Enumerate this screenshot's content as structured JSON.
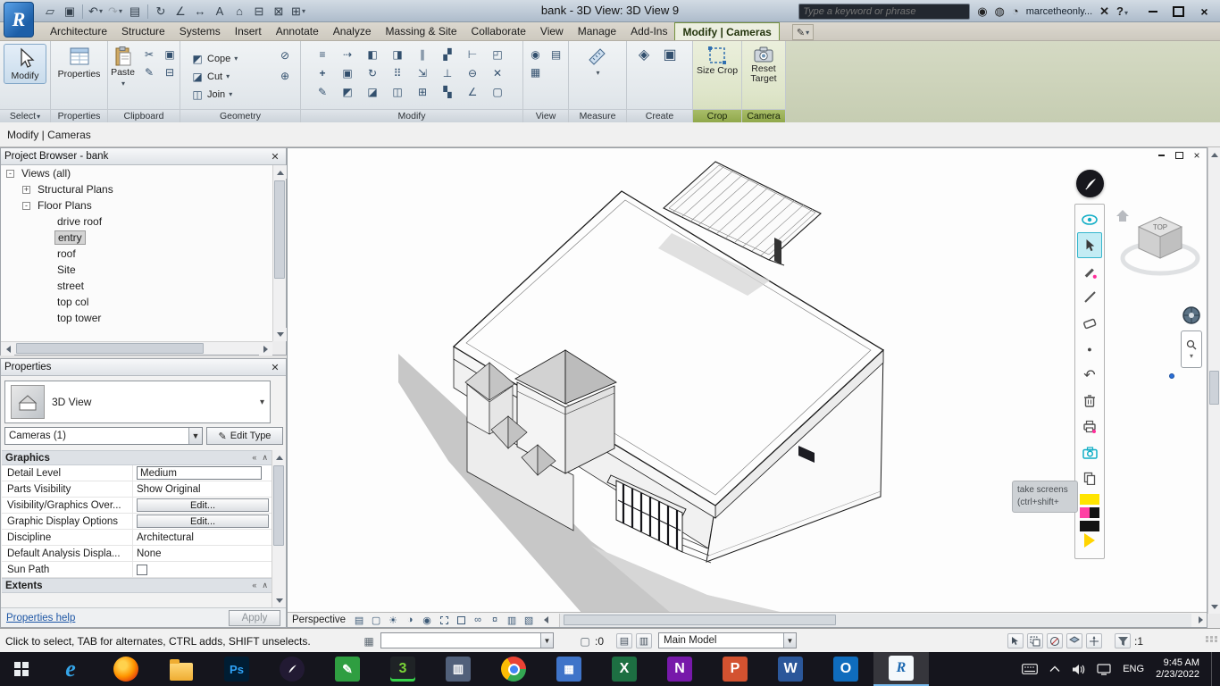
{
  "window": {
    "title": "bank - 3D View: 3D View 9",
    "search_placeholder": "Type a keyword or phrase",
    "user": "marcetheonly..."
  },
  "tabs": {
    "items": [
      "Architecture",
      "Structure",
      "Systems",
      "Insert",
      "Annotate",
      "Analyze",
      "Massing & Site",
      "Collaborate",
      "View",
      "Manage",
      "Add-Ins"
    ],
    "contextual": "Modify | Cameras"
  },
  "ribbon": {
    "select": {
      "button": "Modify",
      "label": "Select"
    },
    "properties_label": "Properties",
    "clipboard": {
      "paste": "Paste",
      "label": "Clipboard"
    },
    "geometry": {
      "cope": "Cope",
      "cut": "Cut",
      "join": "Join",
      "label": "Geometry"
    },
    "modify_label": "Modify",
    "view_label": "View",
    "measure_label": "Measure",
    "create_label": "Create",
    "crop": {
      "button": "Size Crop",
      "label": "Crop"
    },
    "camera": {
      "button": "Reset Target",
      "label": "Camera"
    }
  },
  "options_bar": {
    "label": "Modify | Cameras"
  },
  "project_browser": {
    "title": "Project Browser - bank",
    "items": [
      {
        "label": "Views (all)",
        "expander": "-"
      },
      {
        "label": "Structural Plans",
        "expander": "+"
      },
      {
        "label": "Floor Plans",
        "expander": "-"
      },
      {
        "label": "drive roof"
      },
      {
        "label": "entry"
      },
      {
        "label": "roof"
      },
      {
        "label": "Site"
      },
      {
        "label": "street"
      },
      {
        "label": "top col"
      },
      {
        "label": "top tower"
      }
    ]
  },
  "properties": {
    "title": "Properties",
    "type_selector": "3D View",
    "instance_filter": "Cameras (1)",
    "edit_type": "Edit Type",
    "graphics_header": "Graphics",
    "extents_header": "Extents",
    "rows": [
      {
        "label": "Detail Level",
        "value": "Medium"
      },
      {
        "label": "Parts Visibility",
        "value": "Show Original"
      },
      {
        "label": "Visibility/Graphics Over...",
        "value": "Edit..."
      },
      {
        "label": "Graphic Display Options",
        "value": "Edit..."
      },
      {
        "label": "Discipline",
        "value": "Architectural"
      },
      {
        "label": "Default Analysis Displa...",
        "value": "None"
      },
      {
        "label": "Sun Path",
        "value": ""
      }
    ],
    "help": "Properties help",
    "apply": "Apply"
  },
  "viewport": {
    "cube_top": "TOP",
    "tooltip1": "take screens",
    "tooltip2": "(ctrl+shift+"
  },
  "view_bar": {
    "label": "Perspective"
  },
  "status": {
    "hint": "Click to select, TAB for alternates, CTRL adds, SHIFT unselects.",
    "editable": ":0",
    "model": "Main Model",
    "filter": ":1"
  },
  "taskbar": {
    "lang": "ENG",
    "time": "9:45 AM",
    "date": "2/23/2022"
  }
}
